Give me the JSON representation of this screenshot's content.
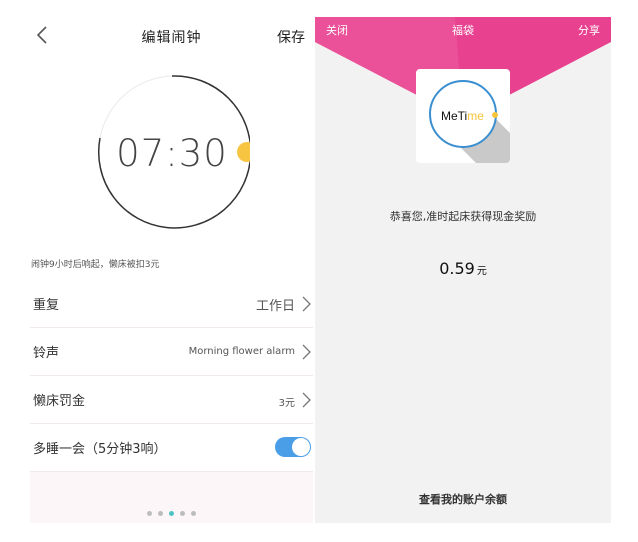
{
  "alarm_edit": {
    "title": "编辑闹钟",
    "save_label": "保存",
    "time": "07:30",
    "hint": "闹钟9小时后响起，懒床被扣3元",
    "rows": [
      {
        "label": "重复",
        "value": "工作日"
      },
      {
        "label": "铃声",
        "value": "Morning flower alarm"
      },
      {
        "label": "懒床罚金",
        "value": "3元"
      },
      {
        "label": "多睡一会（5分钟3响）",
        "toggle_on": true
      }
    ],
    "page_dots": {
      "count": 5,
      "active_index": 2
    },
    "colors": {
      "toggle": "#4a9ee8",
      "sun": "#f7c542",
      "active_dot": "#4ec2c4"
    }
  },
  "reward": {
    "close_label": "关闭",
    "title": "福袋",
    "share_label": "分享",
    "logo_text_pre": "MeTi",
    "logo_text_hl": "me",
    "message": "恭喜您,准时起床获得现金奖励",
    "amount": "0.59",
    "unit": "元",
    "balance_link": "查看我的账户余额",
    "colors": {
      "banner": "#e8418f",
      "background": "#f2f2f2"
    }
  }
}
